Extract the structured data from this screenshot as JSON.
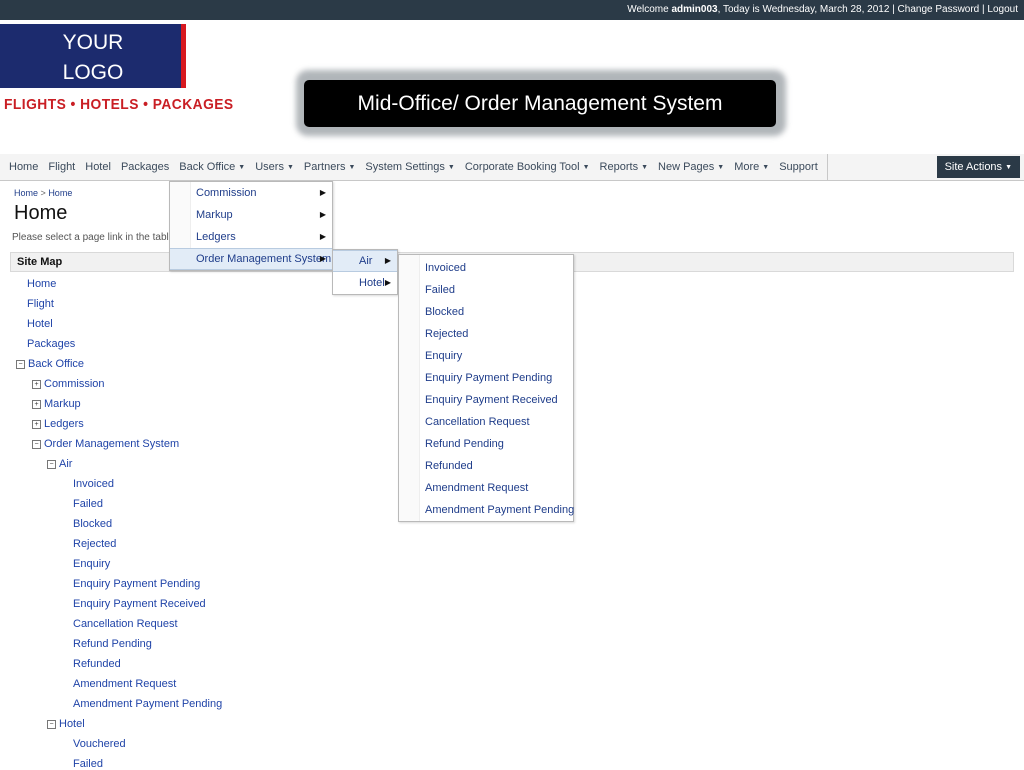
{
  "topbar": {
    "welcome_prefix": "Welcome ",
    "username": "admin003",
    "date_text": ", Today is Wednesday, March 28, 2012 | ",
    "change_password": "Change Password",
    "separator": " | ",
    "logout": "Logout"
  },
  "branding": {
    "logo_line1": "YOUR",
    "logo_line2": "LOGO",
    "tagline": "FLIGHTS • HOTELS • PACKAGES",
    "banner": "Mid-Office/ Order Management System"
  },
  "nav": {
    "items": [
      "Home",
      "Flight",
      "Hotel",
      "Packages",
      "Back Office",
      "Users",
      "Partners",
      "System Settings",
      "Corporate Booking Tool",
      "Reports",
      "New Pages",
      "More",
      "Support"
    ],
    "site_actions": "Site Actions"
  },
  "content": {
    "breadcrumb_home": "Home",
    "breadcrumb_sep": ">",
    "breadcrumb_current": "Home",
    "title": "Home",
    "instruction": "Please select a page link in the table",
    "sitemap_header": "Site Map"
  },
  "tree": {
    "home": "Home",
    "flight": "Flight",
    "hotel": "Hotel",
    "packages": "Packages",
    "back_office": "Back Office",
    "commission": "Commission",
    "markup": "Markup",
    "ledgers": "Ledgers",
    "oms": "Order Management System",
    "air": "Air",
    "air_items": [
      "Invoiced",
      "Failed",
      "Blocked",
      "Rejected",
      "Enquiry",
      "Enquiry Payment Pending",
      "Enquiry Payment Received",
      "Cancellation Request",
      "Refund Pending",
      "Refunded",
      "Amendment Request",
      "Amendment Payment Pending"
    ],
    "hotel_group": "Hotel",
    "hotel_items": [
      "Vouchered",
      "Failed"
    ]
  },
  "menus": {
    "back_office": [
      "Commission",
      "Markup",
      "Ledgers",
      "Order Management System"
    ],
    "oms": [
      "Air",
      "Hotel"
    ],
    "air": [
      "Invoiced",
      "Failed",
      "Blocked",
      "Rejected",
      "Enquiry",
      "Enquiry Payment Pending",
      "Enquiry Payment Received",
      "Cancellation Request",
      "Refund Pending",
      "Refunded",
      "Amendment Request",
      "Amendment Payment Pending"
    ]
  }
}
